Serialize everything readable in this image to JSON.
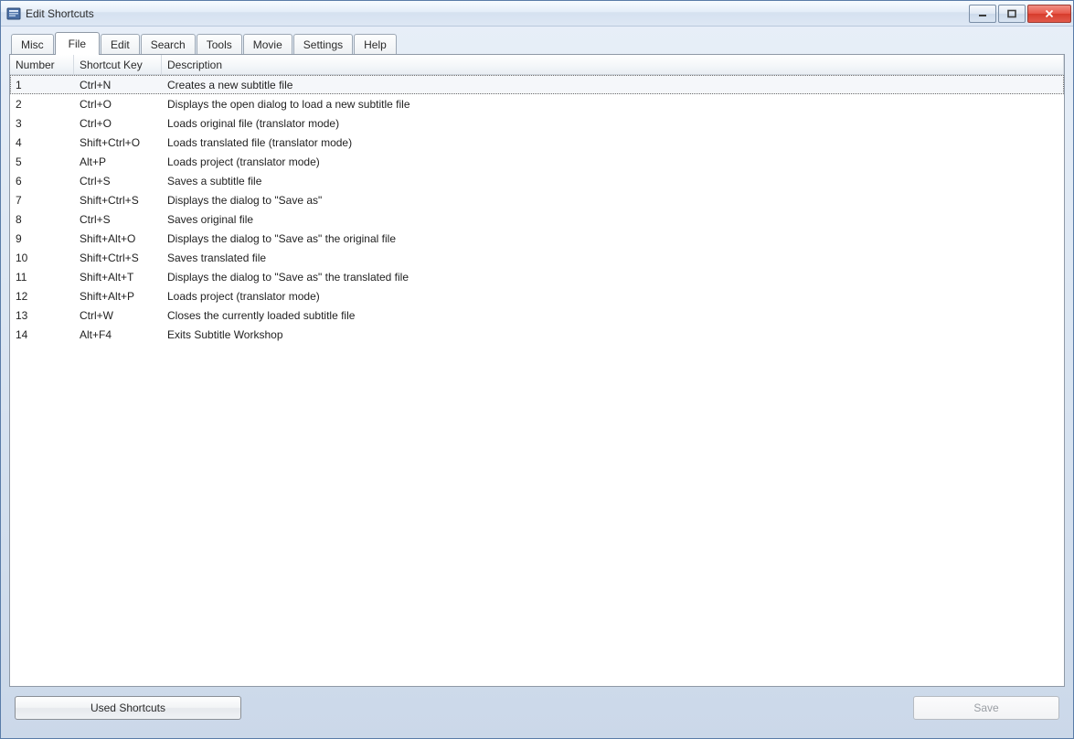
{
  "window": {
    "title": "Edit Shortcuts"
  },
  "tabs": [
    {
      "label": "Misc"
    },
    {
      "label": "File"
    },
    {
      "label": "Edit"
    },
    {
      "label": "Search"
    },
    {
      "label": "Tools"
    },
    {
      "label": "Movie"
    },
    {
      "label": "Settings"
    },
    {
      "label": "Help"
    }
  ],
  "active_tab_index": 1,
  "columns": {
    "number": "Number",
    "shortcut": "Shortcut Key",
    "description": "Description"
  },
  "rows": [
    {
      "number": "1",
      "shortcut": "Ctrl+N",
      "description": "Creates a new subtitle file"
    },
    {
      "number": "2",
      "shortcut": "Ctrl+O",
      "description": "Displays the open dialog to load a new subtitle file"
    },
    {
      "number": "3",
      "shortcut": "Ctrl+O",
      "description": "Loads original file (translator mode)"
    },
    {
      "number": "4",
      "shortcut": "Shift+Ctrl+O",
      "description": "Loads translated file (translator mode)"
    },
    {
      "number": "5",
      "shortcut": "Alt+P",
      "description": "Loads project (translator mode)"
    },
    {
      "number": "6",
      "shortcut": "Ctrl+S",
      "description": "Saves a subtitle file"
    },
    {
      "number": "7",
      "shortcut": "Shift+Ctrl+S",
      "description": "Displays the dialog to \"Save as\""
    },
    {
      "number": "8",
      "shortcut": "Ctrl+S",
      "description": "Saves original file"
    },
    {
      "number": "9",
      "shortcut": "Shift+Alt+O",
      "description": "Displays the dialog to \"Save as\" the original file"
    },
    {
      "number": "10",
      "shortcut": "Shift+Ctrl+S",
      "description": "Saves translated file"
    },
    {
      "number": "11",
      "shortcut": "Shift+Alt+T",
      "description": "Displays the dialog to \"Save as\" the translated file"
    },
    {
      "number": "12",
      "shortcut": "Shift+Alt+P",
      "description": "Loads project (translator mode)"
    },
    {
      "number": "13",
      "shortcut": "Ctrl+W",
      "description": "Closes the currently loaded subtitle file"
    },
    {
      "number": "14",
      "shortcut": "Alt+F4",
      "description": "Exits Subtitle Workshop"
    }
  ],
  "selected_row_index": 0,
  "buttons": {
    "used_shortcuts": "Used Shortcuts",
    "save": "Save"
  }
}
